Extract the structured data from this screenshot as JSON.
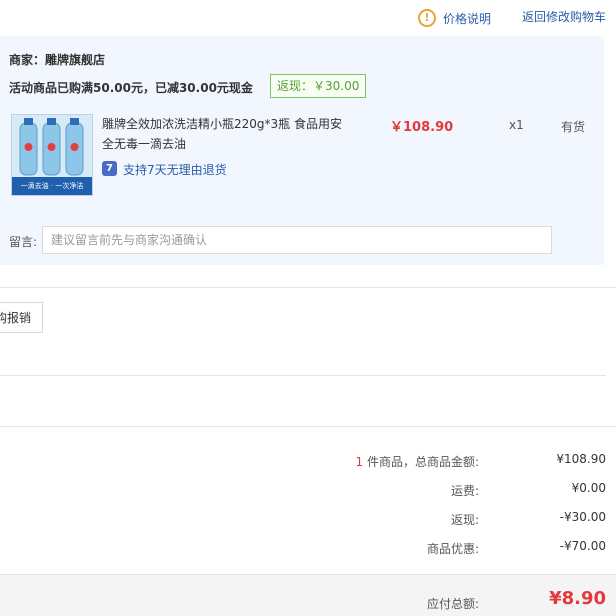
{
  "header": {
    "price_explain": "价格说明",
    "back_to_cart": "返回修改购物车",
    "warn_glyph": "!"
  },
  "shop": {
    "label": "商家：雕牌旗舰店",
    "promo": "活动商品已购满50.00元，已减30.00元现金",
    "cashback": "返现：￥30.00"
  },
  "product": {
    "title": "雕牌全效加浓洗洁精小瓶220g*3瓶 食品用安全无毒一滴去油",
    "price": "￥108.90",
    "qty": "x1",
    "stock": "有货",
    "return_icon_glyph": "7",
    "return_policy": "支持7天无理由退货",
    "image_caption": "一滴去油 · 一次净洁"
  },
  "message": {
    "label": "留言:",
    "placeholder": "建议留言前先与商家沟通确认"
  },
  "invoice": {
    "label": "购报销"
  },
  "summary": {
    "item_count": "1",
    "item_total_label": " 件商品，总商品金额:",
    "item_total": "¥108.90",
    "shipping_label": "运费:",
    "shipping": "¥0.00",
    "cashback_label": "返现:",
    "cashback": "-¥30.00",
    "discount_label": "商品优惠:",
    "discount": "-¥70.00",
    "payable_label": "应付总额:",
    "payable": "¥8.90"
  },
  "colors": {
    "accent_red": "#e4393c",
    "link_blue": "#2a5caa",
    "block_bg": "#f2f7ff",
    "badge_green": "#5a9e3a",
    "warn_orange": "#e8a33d"
  },
  "icons": [
    "warning-icon",
    "return-policy-icon",
    "product-image"
  ]
}
